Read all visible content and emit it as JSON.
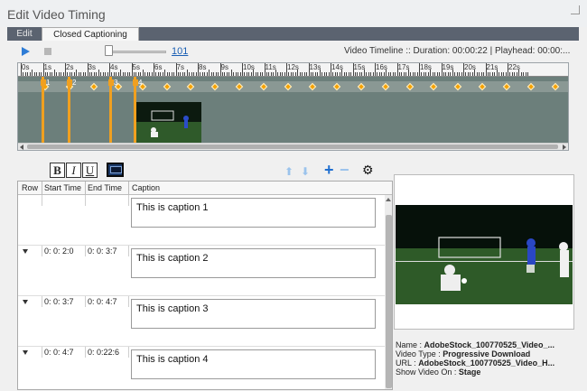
{
  "window": {
    "title": "Edit Video Timing"
  },
  "tabs": [
    {
      "label": "Edit"
    },
    {
      "label": "Closed Captioning"
    }
  ],
  "toolbar": {
    "zoom_value": "101",
    "timeline_info": "Video Timeline :: Duration: 00:00:22  |  Playhead: 00:00:..."
  },
  "timeline": {
    "ruler_labels": [
      "0s",
      "1s",
      "2s",
      "3s",
      "4s",
      "5s",
      "6s",
      "7s",
      "8s",
      "9s",
      "10s",
      "11s",
      "12s",
      "13s",
      "14s",
      "15s",
      "16s",
      "17s",
      "18s",
      "19s",
      "20s",
      "21s",
      "22s"
    ],
    "markers": [
      "1",
      "2",
      "3",
      "4"
    ],
    "duration_seconds": 22,
    "keyframe_icon": "diamond-icon"
  },
  "format_bar": {
    "bold": "B",
    "italic": "I",
    "underline": "U"
  },
  "grid": {
    "columns": [
      "Row",
      "Start Time",
      "End Time",
      "Caption"
    ],
    "rows": [
      {
        "start": "",
        "end": "",
        "caption": "This is caption 1"
      },
      {
        "start": "0: 0: 2:0",
        "end": "0: 0: 3:7",
        "caption": "This is caption 2"
      },
      {
        "start": "0: 0: 3:7",
        "end": "0: 0: 4:7",
        "caption": "This is caption 3"
      },
      {
        "start": "0: 0: 4:7",
        "end": "0: 0:22:6",
        "caption": "This is caption 4"
      }
    ]
  },
  "info": {
    "name_label": "Name :",
    "name_value": "AdobeStock_100770525_Video_...",
    "type_label": "Video Type :",
    "type_value": "Progressive Download",
    "url_label": "URL :",
    "url_value": "AdobeStock_100770525_Video_H...",
    "show_label": "Show Video On :",
    "show_value": "Stage"
  },
  "colors": {
    "accent": "#2e7cd6",
    "marker": "#f0a020",
    "playhead": "#e0322c",
    "track": "#6c7f7b"
  }
}
